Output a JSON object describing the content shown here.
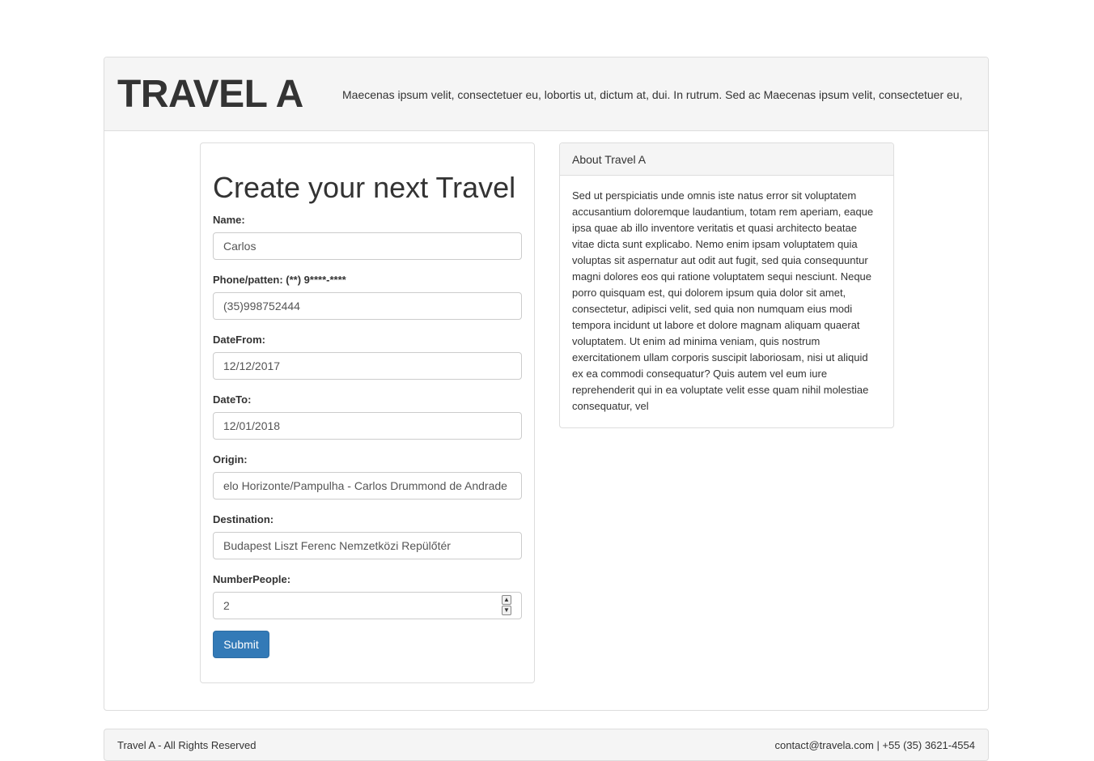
{
  "header": {
    "brand": "TRAVEL A",
    "tagline": "Maecenas ipsum velit, consectetuer eu, lobortis ut, dictum at, dui. In rutrum. Sed ac Maecenas ipsum velit, consectetuer eu, lo"
  },
  "form": {
    "title": "Create your next Travel",
    "fields": {
      "name": {
        "label": "Name:",
        "value": "Carlos"
      },
      "phone": {
        "label": "Phone/patten: (**) 9****-****",
        "value": "(35)998752444"
      },
      "date_from": {
        "label": "DateFrom:",
        "value": "12/12/2017"
      },
      "date_to": {
        "label": "DateTo:",
        "value": "12/01/2018"
      },
      "origin": {
        "label": "Origin:",
        "value": "elo Horizonte/Pampulha - Carlos Drummond de Andrade"
      },
      "destination": {
        "label": "Destination:",
        "value": "Budapest Liszt Ferenc Nemzetközi Repülőtér"
      },
      "number_people": {
        "label": "NumberPeople:",
        "value": "2"
      }
    },
    "submit_label": "Submit"
  },
  "about": {
    "heading": "About Travel A",
    "body": "Sed ut perspiciatis unde omnis iste natus error sit voluptatem accusantium doloremque laudantium, totam rem aperiam, eaque ipsa quae ab illo inventore veritatis et quasi architecto beatae vitae dicta sunt explicabo. Nemo enim ipsam voluptatem quia voluptas sit aspernatur aut odit aut fugit, sed quia consequuntur magni dolores eos qui ratione voluptatem sequi nesciunt. Neque porro quisquam est, qui dolorem ipsum quia dolor sit amet, consectetur, adipisci velit, sed quia non numquam eius modi tempora incidunt ut labore et dolore magnam aliquam quaerat voluptatem. Ut enim ad minima veniam, quis nostrum exercitationem ullam corporis suscipit laboriosam, nisi ut aliquid ex ea commodi consequatur? Quis autem vel eum iure reprehenderit qui in ea voluptate velit esse quam nihil molestiae consequatur, vel"
  },
  "footer": {
    "left": "Travel A - All Rights Reserved",
    "right": "contact@travela.com | +55 (35) 3621-4554"
  },
  "icons": {
    "spin_up": "chevron-up-icon",
    "spin_down": "chevron-down-icon"
  }
}
